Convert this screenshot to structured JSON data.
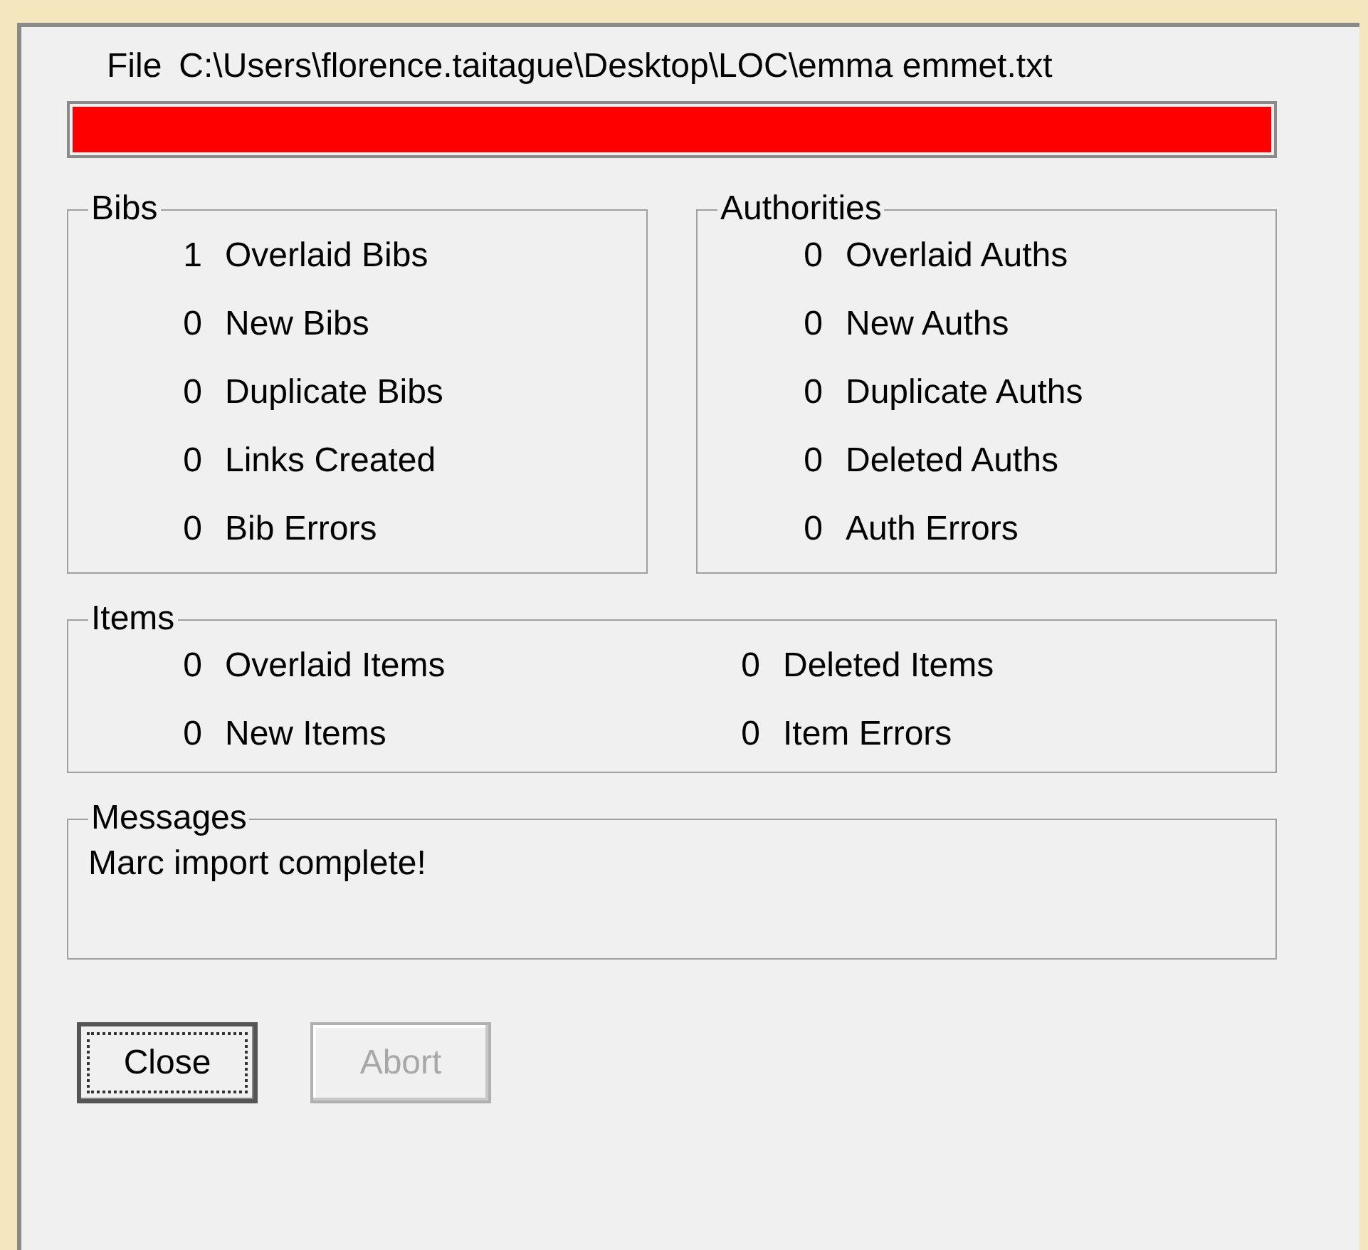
{
  "file": {
    "label": "File",
    "path": "C:\\Users\\florence.taitague\\Desktop\\LOC\\emma emmet.txt"
  },
  "progress": {
    "level": 1
  },
  "bibs": {
    "title": "Bibs",
    "rows": [
      {
        "count": "1",
        "label": "Overlaid Bibs"
      },
      {
        "count": "0",
        "label": "New Bibs"
      },
      {
        "count": "0",
        "label": "Duplicate Bibs"
      },
      {
        "count": "0",
        "label": "Links Created"
      },
      {
        "count": "0",
        "label": "Bib Errors"
      }
    ]
  },
  "authorities": {
    "title": "Authorities",
    "rows": [
      {
        "count": "0",
        "label": "Overlaid Auths"
      },
      {
        "count": "0",
        "label": "New Auths"
      },
      {
        "count": "0",
        "label": "Duplicate Auths"
      },
      {
        "count": "0",
        "label": "Deleted Auths"
      },
      {
        "count": "0",
        "label": "Auth Errors"
      }
    ]
  },
  "items": {
    "title": "Items",
    "rows": [
      {
        "count": "0",
        "label": "Overlaid Items"
      },
      {
        "count": "0",
        "label": "Deleted Items"
      },
      {
        "count": "0",
        "label": "New Items"
      },
      {
        "count": "0",
        "label": "Item Errors"
      }
    ]
  },
  "messages": {
    "title": "Messages",
    "text": "Marc import complete!"
  },
  "buttons": [
    {
      "label": "Close",
      "disabled": false,
      "focused": true
    },
    {
      "label": "Abort",
      "disabled": true,
      "focused": false
    }
  ]
}
